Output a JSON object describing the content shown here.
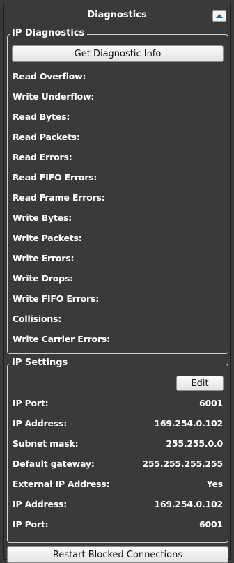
{
  "panel": {
    "title": "Diagnostics",
    "collapse_icon": "chevron-up-icon",
    "accent": "#1a63c4"
  },
  "ip_diagnostics": {
    "title": "IP Diagnostics",
    "button_label": "Get Diagnostic Info",
    "rows": [
      {
        "label": "Read Overflow:"
      },
      {
        "label": "Write Underflow:"
      },
      {
        "label": "Read Bytes:"
      },
      {
        "label": "Read Packets:"
      },
      {
        "label": "Read Errors:"
      },
      {
        "label": "Read FIFO Errors:"
      },
      {
        "label": "Read Frame Errors:"
      },
      {
        "label": "Write Bytes:"
      },
      {
        "label": "Write Packets:"
      },
      {
        "label": "Write Errors:"
      },
      {
        "label": "Write Drops:"
      },
      {
        "label": "Write FIFO Errors:"
      },
      {
        "label": "Collisions:"
      },
      {
        "label": "Write Carrier Errors:"
      }
    ]
  },
  "ip_settings": {
    "title": "IP Settings",
    "edit_label": "Edit",
    "rows": [
      {
        "label": "IP Port:",
        "value": "6001"
      },
      {
        "label": "IP Address:",
        "value": "169.254.0.102"
      },
      {
        "label": "Subnet mask:",
        "value": "255.255.0.0"
      },
      {
        "label": "Default gateway:",
        "value": "255.255.255.255"
      },
      {
        "label": "External IP Address:",
        "value": "Yes"
      },
      {
        "label": "IP Address:",
        "value": "169.254.0.102"
      },
      {
        "label": "IP Port:",
        "value": "6001"
      }
    ]
  },
  "footer": {
    "restart_label": "Restart Blocked Connections"
  }
}
